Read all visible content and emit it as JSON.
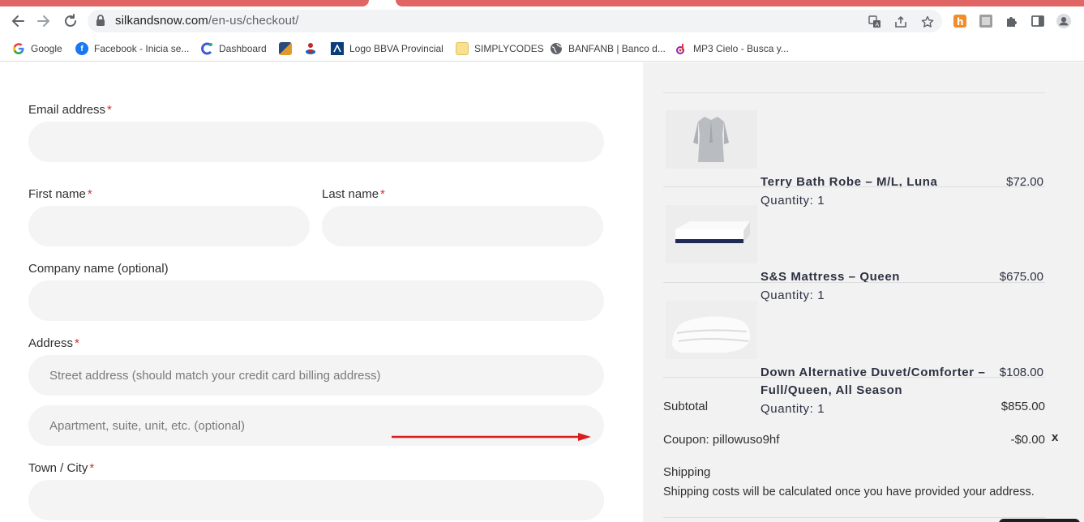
{
  "browser": {
    "url_host": "silkandsnow.com",
    "url_path": "/en-us/checkout/",
    "accent_color": "#e06666",
    "icons": [
      "back-arrow-icon",
      "forward-arrow-icon",
      "reload-icon",
      "lock-icon",
      "translate-icon",
      "share-icon",
      "star-icon",
      "extension-orange-icon",
      "extension-gray-icon",
      "puzzle-icon",
      "side-panel-icon",
      "profile-icon"
    ]
  },
  "bookmarks": [
    {
      "label": "Google",
      "icon": "google-icon"
    },
    {
      "label": "Facebook - Inicia se...",
      "icon": "facebook-icon"
    },
    {
      "label": "Dashboard",
      "icon": "dashboard-icon"
    },
    {
      "label": "",
      "icon": "bookmark-image-icon"
    },
    {
      "label": "",
      "icon": "bookmark-figure-icon"
    },
    {
      "label": "Logo BBVA Provincial",
      "icon": "bbva-icon"
    },
    {
      "label": "SIMPLYCODES",
      "icon": "folder-icon"
    },
    {
      "label": "BANFANB | Banco d...",
      "icon": "globe-icon"
    },
    {
      "label": "MP3 Cielo - Busca y...",
      "icon": "mp3-icon"
    }
  ],
  "form": {
    "email_label": "Email address",
    "first_name_label": "First name",
    "last_name_label": "Last name",
    "company_label": "Company name (optional)",
    "address_label": "Address",
    "street_placeholder": "Street address (should match your credit card billing address)",
    "apartment_placeholder": "Apartment, suite, unit, etc. (optional)",
    "city_label": "Town / City",
    "required_mark": "*"
  },
  "order": {
    "items": [
      {
        "name": "Terry Bath Robe – M/L, Luna",
        "name_line2": "",
        "quantity": "Quantity: 1",
        "price": "$72.00"
      },
      {
        "name": "S&S Mattress – Queen",
        "name_line2": "",
        "quantity": "Quantity: 1",
        "price": "$675.00"
      },
      {
        "name": "Down Alternative Duvet/Comforter –",
        "name_line2": "Full/Queen, All Season",
        "quantity": "Quantity: 1",
        "price": "$108.00"
      }
    ],
    "subtotal_label": "Subtotal",
    "subtotal_value": "$855.00",
    "coupon_label": "Coupon: pillowuso9hf",
    "coupon_value": "-$0.00",
    "coupon_remove": "x",
    "shipping_label": "Shipping",
    "shipping_note": "Shipping costs will be calculated once you have provided your address."
  }
}
